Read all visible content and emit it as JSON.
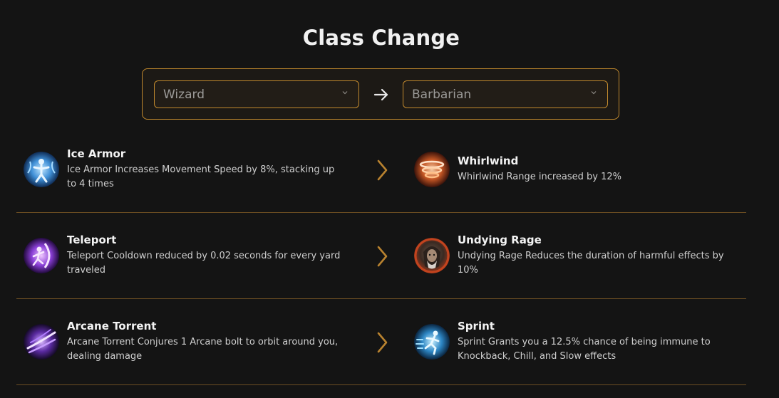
{
  "title": "Class Change",
  "class_select": {
    "from": "Wizard",
    "to": "Barbarian"
  },
  "colors": {
    "accent": "#c28a2e",
    "background": "#141414",
    "divider": "#6b4d22"
  },
  "rows": [
    {
      "from": {
        "name": "Ice Armor",
        "description": "Ice Armor Increases Movement Speed by 8%, stacking up to 4 times",
        "icon": "ice-armor-icon"
      },
      "to": {
        "name": "Whirlwind",
        "description": "Whirlwind Range increased by 12%",
        "icon": "whirlwind-icon"
      }
    },
    {
      "from": {
        "name": "Teleport",
        "description": "Teleport Cooldown reduced by 0.02 seconds for every yard traveled",
        "icon": "teleport-icon"
      },
      "to": {
        "name": "Undying Rage",
        "description": "Undying Rage Reduces the duration of harmful effects by 10%",
        "icon": "undying-rage-icon"
      }
    },
    {
      "from": {
        "name": "Arcane Torrent",
        "description": "Arcane Torrent Conjures 1 Arcane bolt to orbit around you, dealing damage",
        "icon": "arcane-torrent-icon"
      },
      "to": {
        "name": "Sprint",
        "description": "Sprint Grants you a 12.5% chance of being immune to Knockback, Chill, and Slow effects",
        "icon": "sprint-icon"
      }
    }
  ]
}
